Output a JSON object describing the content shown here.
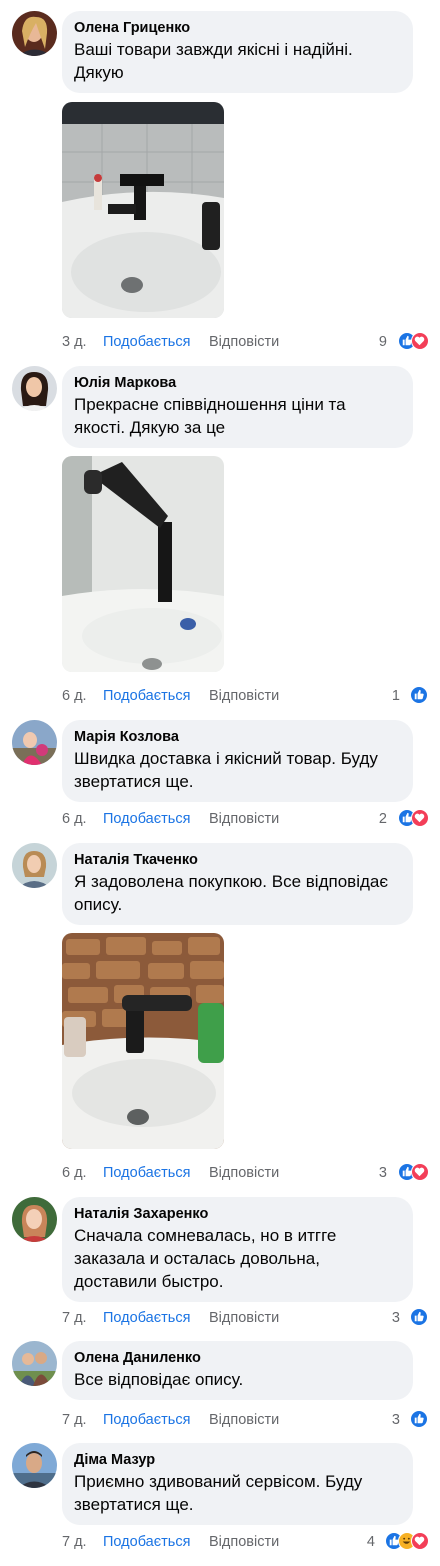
{
  "labels": {
    "like": "Подобається",
    "reply": "Відповісти"
  },
  "colors": {
    "link": "#1b74e4",
    "meta": "#65676b",
    "bubble": "#f0f2f5",
    "like_reaction": "#1b74e4",
    "love_reaction": "#f33e58",
    "haha_reaction": "#f7b125"
  },
  "comments": [
    {
      "author": "Олена Гриценко",
      "text": "Ваші товари завжди якісні і надійні. Дякую",
      "time": "3 д.",
      "reactions_count": "9",
      "reactions": [
        "like-icon",
        "love-icon"
      ],
      "has_photo": true
    },
    {
      "author": "Юлія Маркова",
      "text": "Прекрасне співвідношення ціни та якості. Дякую за це",
      "time": "6 д.",
      "reactions_count": "1",
      "reactions": [
        "like-icon"
      ],
      "has_photo": true
    },
    {
      "author": "Марія Козлова",
      "text": "Швидка доставка і якісний товар. Буду звертатися ще.",
      "time": "6 д.",
      "reactions_count": "2",
      "reactions": [
        "like-icon",
        "love-icon"
      ],
      "has_photo": false
    },
    {
      "author": "Наталія Ткаченко",
      "text": "Я задоволена покупкою. Все відповідає опису.",
      "time": "6 д.",
      "reactions_count": "3",
      "reactions": [
        "like-icon",
        "love-icon"
      ],
      "has_photo": true
    },
    {
      "author": "Наталія Захаренко",
      "text": "Сначала сомневалась, но в итгге заказала и осталась довольна, доставили быстро.",
      "time": "7 д.",
      "reactions_count": "3",
      "reactions": [
        "like-icon"
      ],
      "has_photo": false
    },
    {
      "author": "Олена Даниленко",
      "text": "Все відповідає опису.",
      "time": "7 д.",
      "reactions_count": "3",
      "reactions": [
        "like-icon"
      ],
      "has_photo": false
    },
    {
      "author": "Діма Мазур",
      "text": "Приємно здивований сервісом. Буду звертатися ще.",
      "time": "7 д.",
      "reactions_count": "4",
      "reactions": [
        "like-icon",
        "haha-icon",
        "love-icon"
      ],
      "has_photo": false
    }
  ]
}
